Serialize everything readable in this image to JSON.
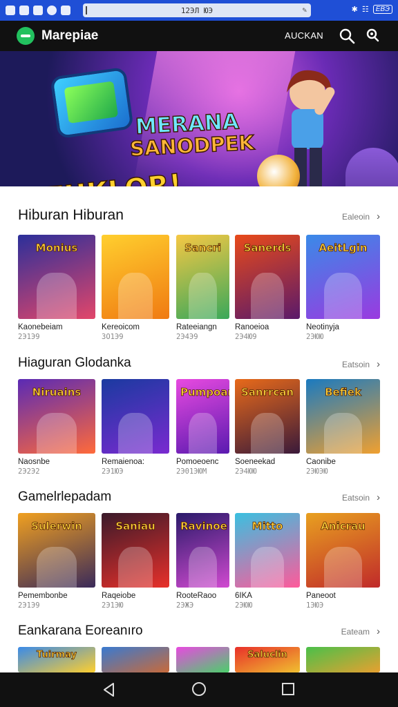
{
  "status_bar": {
    "url": "12ЭЛ ЮЭ",
    "battery": "ЕВЭ"
  },
  "app_bar": {
    "brand": "Marepiae",
    "account_label": "AUCKAN"
  },
  "hero": {
    "line1": "MERANA",
    "line2": "SANODPEK",
    "line3": "ZUKLOR!"
  },
  "colors": {
    "status_bar_bg": "#1f4fd6",
    "app_bar_bg": "#111111",
    "brand_green": "#22c15e"
  },
  "sections": [
    {
      "title": "Hiburan Hiburan",
      "see_all": "Ealeoin",
      "items": [
        {
          "name": "Kaonebeiam",
          "meta": "2Э1Э9",
          "art": "Monius",
          "colors": [
            "#2b2f9a",
            "#e2466a"
          ]
        },
        {
          "name": "Kereoicom",
          "meta": "3O1Э9",
          "art": "",
          "colors": [
            "#ffcf2e",
            "#f07a12"
          ]
        },
        {
          "name": "Rateeiangn",
          "meta": "2Э4Э9",
          "art": "Sancri",
          "colors": [
            "#f6c844",
            "#3aa85a"
          ]
        },
        {
          "name": "Ranoeioa",
          "meta": "2Э4Ю9",
          "art": "Sanerds",
          "colors": [
            "#e84a1a",
            "#5a1a6a"
          ]
        },
        {
          "name": "Neotinyja",
          "meta": "2ЭЮЮ",
          "art": "AeitLgin",
          "colors": [
            "#3a8ae8",
            "#9a3ae0"
          ]
        }
      ]
    },
    {
      "title": "Hiaguran Glodanka",
      "see_all": "Eatsoin",
      "items": [
        {
          "name": "Naosnbe",
          "meta": "2Э2Э2",
          "art": "Niruains",
          "colors": [
            "#5a2ab5",
            "#ff6a3a"
          ]
        },
        {
          "name": "Remaienoa:",
          "meta": "2Э1ЮЭ",
          "art": "",
          "colors": [
            "#1a3aa0",
            "#7a2ad0"
          ]
        },
        {
          "name": "Pomoeoenc",
          "meta": "2Э01ЭЮМ",
          "art": "Pumpoan",
          "colors": [
            "#e84ae0",
            "#5a1ab0"
          ]
        },
        {
          "name": "Soeneekad",
          "meta": "2Э4ЮЮ",
          "art": "Sanrrcan",
          "colors": [
            "#e86a1a",
            "#3a1a3a"
          ]
        },
        {
          "name": "Caonibe",
          "meta": "2ЭЮЭЮ",
          "art": "Befiek",
          "colors": [
            "#1a7ac0",
            "#f0a030"
          ]
        }
      ]
    },
    {
      "title": "Gamelrlepadam",
      "see_all": "Eatsoin",
      "items": [
        {
          "name": "Pemembonbe",
          "meta": "2Э1Э9",
          "art": "Sulerwin",
          "colors": [
            "#f0a020",
            "#3a2a5a"
          ]
        },
        {
          "name": "Raqeiobe",
          "meta": "2Э1ЭЮ",
          "art": "Saniau",
          "colors": [
            "#3a1a2a",
            "#e8302a"
          ]
        },
        {
          "name": "RooteRaoo",
          "meta": "2ЭЖЭ",
          "art": "Ravinoe",
          "colors": [
            "#2a1a6a",
            "#d04ad0"
          ]
        },
        {
          "name": "6IKA",
          "meta": "2ЭЮЮ",
          "art": "Mitto",
          "colors": [
            "#3ac0e0",
            "#ff5a9a"
          ]
        },
        {
          "name": "Paneoot",
          "meta": "1ЭЮЭ",
          "art": "Anicrau",
          "colors": [
            "#e8a020",
            "#c02a2a"
          ]
        }
      ]
    },
    {
      "title": "Eankarana Eoreanıro",
      "see_all": "Eateam",
      "items": [
        {
          "name": "",
          "meta": "",
          "art": "Tuirmay",
          "colors": [
            "#3a8ae8",
            "#ffcf2e"
          ]
        },
        {
          "name": "",
          "meta": "",
          "art": "",
          "colors": [
            "#3a7ad0",
            "#c86a3a"
          ]
        },
        {
          "name": "",
          "meta": "",
          "art": "",
          "colors": [
            "#e84ae0",
            "#4ad06a"
          ]
        },
        {
          "name": "",
          "meta": "",
          "art": "Saluclin",
          "colors": [
            "#e8302a",
            "#f0c030"
          ]
        },
        {
          "name": "",
          "meta": "",
          "art": "",
          "colors": [
            "#4ac04a",
            "#e8a030"
          ]
        }
      ]
    }
  ],
  "nav": {
    "back_icon": "triangle-back-icon",
    "home_icon": "circle-home-icon",
    "recents_icon": "square-recents-icon"
  }
}
